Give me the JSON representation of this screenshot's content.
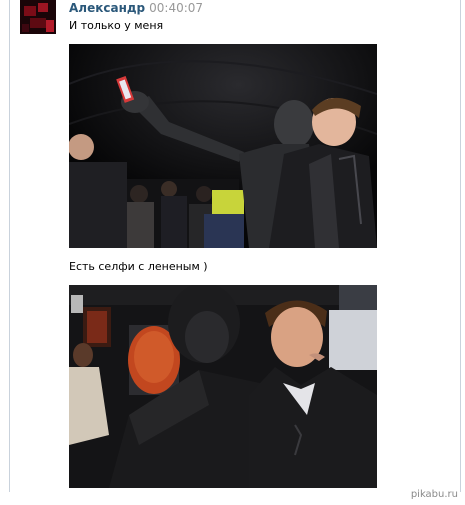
{
  "message": {
    "author": "Александр",
    "time": "00:40:07",
    "text_1": "И только у меня",
    "text_2": "Есть селфи с лененым )"
  },
  "images": {
    "photo_1": "selfie-with-statue-photo",
    "photo_2": "second-selfie-with-statue-photo"
  },
  "watermark": "pikabu.ru",
  "colors": {
    "author": "#2b587a",
    "time": "#999999",
    "divider": "#c9d2dc"
  }
}
